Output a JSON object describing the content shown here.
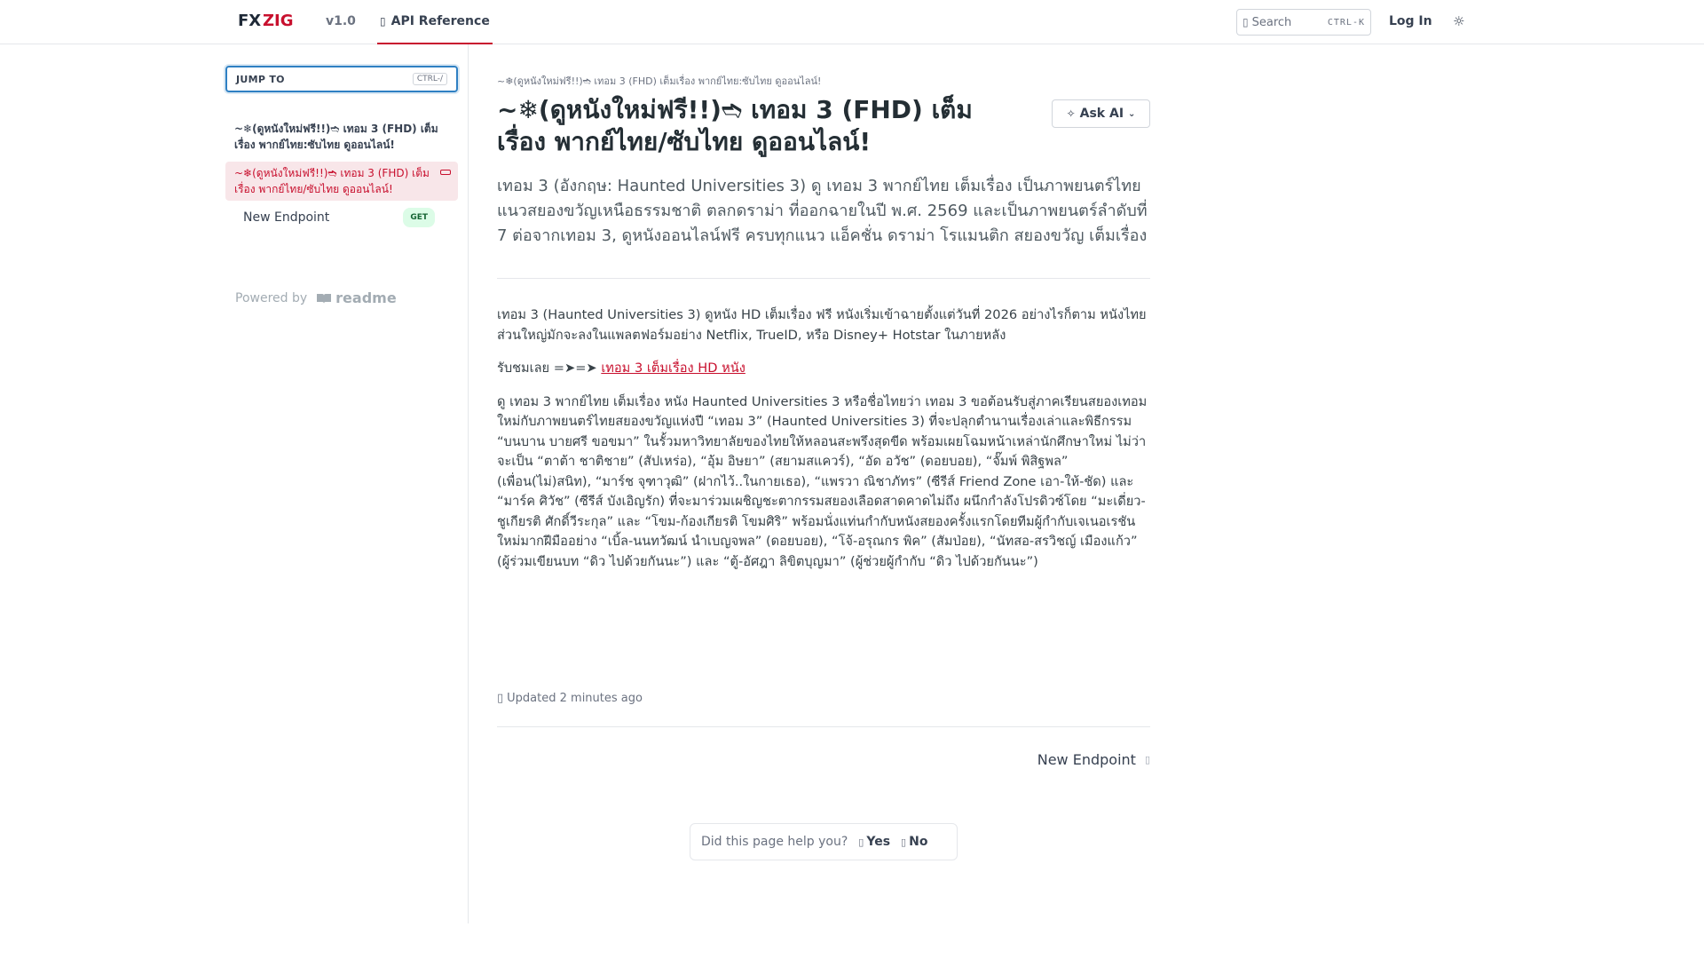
{
  "header": {
    "logo_text": "FXZIG",
    "version": "v1.0",
    "nav_tab": "API Reference",
    "search_label": "Search",
    "search_shortcut": "CTRL-K",
    "login": "Log In"
  },
  "sidebar": {
    "jump_to_label": "JUMP TO",
    "jump_to_shortcut": "CTRL-/",
    "items": [
      {
        "label": "~❄(ดูหนังใหม่ฟรี!!)➬ เทอม 3 (FHD) เต็มเรื่อง พากย์ไทย:ซับไทย ดูออนไลน์!"
      },
      {
        "label": "~❄(ดูหนังใหม่ฟรี!!)➬ เทอม 3 (FHD) เต็มเรื่อง พากย์ไทย/ซับไทย ดูออนไลน์!"
      },
      {
        "label": "New Endpoint",
        "method": "GET"
      }
    ],
    "powered_by": "Powered by",
    "readme_brand": "readme"
  },
  "main": {
    "breadcrumb": "~❄(ดูหนังใหม่ฟรี!!)➬ เทอม 3 (FHD) เต็มเรื่อง พากย์ไทย:ซับไทย ดูออนไลน์!",
    "title": "~❄(ดูหนังใหม่ฟรี!!)➬ เทอม 3 (FHD) เต็มเรื่อง พากย์ไทย/ซับไทย ดูออนไลน์!",
    "ask_ai": "Ask AI",
    "excerpt": "เทอม 3 (อังกฤษ: Haunted Universities 3) ดู เทอม 3 พากย์ไทย เต็มเรื่อง เป็นภาพยนตร์ไทยแนวสยองขวัญเหนือธรรมชาติ ตลกดราม่า ที่ออกฉายในปี พ.ศ. 2569 และเป็นภาพยนตร์ลำดับที่ 7 ต่อจากเทอม 3, ดูหนังออนไลน์ฟรี ครบทุกแนว แอ็คชั่น ดราม่า โรแมนติก สยองขวัญ เต็มเรื่อง",
    "para1": "เทอม 3 (Haunted Universities 3) ดูหนัง HD เต็มเรื่อง ฟรี หนังเริ่มเข้าฉายตั้งแต่วันที่ 2026 อย่างไรก็ตาม หนังไทยส่วนใหญ่มักจะลงในแพลตฟอร์มอย่าง Netflix, TrueID, หรือ Disney+ Hotstar ในภายหลัง",
    "para2_prefix": "รับชมเลย =➤=➤ ",
    "para2_link": "เทอม 3 เต็มเรื่อง HD หนัง",
    "para3": "ดู เทอม 3 พากย์ไทย เต็มเรื่อง หนัง Haunted Universities 3 หรือชื่อไทยว่า เทอม 3 ขอต้อนรับสู่ภาคเรียนสยองเทอมใหม่กับภาพยนตร์ไทยสยองขวัญแห่งปี “เทอม 3” (Haunted Universities 3) ที่จะปลุกตำนานเรื่องเล่าและพิธีกรรม “บนบาน บายศรี ขอขมา” ในรั้วมหาวิทยาลัยของไทยให้หลอนสะพรึงสุดขีด พร้อมเผยโฉมหน้าเหล่านักศึกษาใหม่ ไม่ว่าจะเป็น “ตาต้า ชาติชาย” (สัปเหร่อ), “อุ้ม อิษยา” (สยามสแควร์), “อัด อวัช” (ดอยบอย), “จั๊มพ์ พิสิฐพล” (เพื่อน(ไม่)สนิท), “มาร์ช จุฑาวุฒิ” (ฝากไว้..ในกายเธอ), “แพรวา ณิชาภัทร” (ซีรีส์ Friend Zone เอา-ให้-ชัด) และ “มาร์ค ศิวัช” (ซีรีส์ บังเอิญรัก) ที่จะมาร่วมเผชิญชะตากรรมสยองเลือดสาดคาดไม่ถึง ผนึกกำลังโปรดิวซ์โดย “มะเดี่ยว-ชูเกียรติ ศักดิ์วีระกุล” และ “โขม-ก้องเกียรติ โขมศิริ” พร้อมนั่งแท่นกำกับหนังสยองครั้งแรกโดยทีมผู้กำกับเจเนอเรชันใหม่มากฝีมืออย่าง “เบิ้ล-นนทวัฒน์ นำเบญจพล” (ดอยบอย), “โจ้-อรุณกร พิค” (สัมป่อย), “นัทสอ-สรวิชญ์ เมืองแก้ว” (ผู้ร่วมเขียนบท “ดิว ไปด้วยกันนะ”) และ “ตู้-อัศฎา ลิขิตบุญมา” (ผู้ช่วยผู้กำกับ “ดิว ไปด้วยกันนะ”)",
    "updated": "Updated 2 minutes ago",
    "next_label": "New Endpoint",
    "feedback_question": "Did this page help you?",
    "feedback_yes": "Yes",
    "feedback_no": "No"
  },
  "colors": {
    "accent": "#c8102e",
    "focus": "#2f80c3",
    "get_badge_bg": "#dcfce7",
    "get_badge_text": "#166534"
  },
  "icons": [
    "book-icon",
    "search-icon",
    "sun-moon-icon",
    "collapse-icon",
    "readme-logo-icon",
    "sparkle-icon",
    "chevron-down-icon",
    "clock-icon",
    "arrow-right-icon",
    "thumbs-up-icon",
    "thumbs-down-icon"
  ]
}
